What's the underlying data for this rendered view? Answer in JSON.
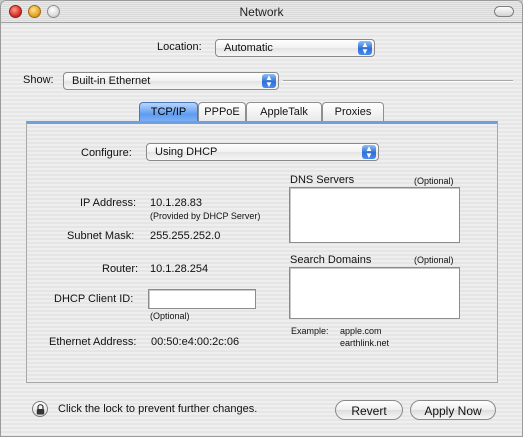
{
  "window": {
    "title": "Network"
  },
  "location": {
    "label": "Location:",
    "value": "Automatic"
  },
  "show": {
    "label": "Show:",
    "value": "Built-in Ethernet"
  },
  "tabs": [
    "TCP/IP",
    "PPPoE",
    "AppleTalk",
    "Proxies"
  ],
  "active_tab": "TCP/IP",
  "configure": {
    "label": "Configure:",
    "value": "Using DHCP"
  },
  "ip": {
    "label": "IP Address:",
    "value": "10.1.28.83",
    "note": "(Provided by DHCP Server)"
  },
  "subnet": {
    "label": "Subnet Mask:",
    "value": "255.255.252.0"
  },
  "router": {
    "label": "Router:",
    "value": "10.1.28.254"
  },
  "dhcp_client_id": {
    "label": "DHCP Client ID:",
    "value": "",
    "note": "(Optional)"
  },
  "ethernet": {
    "label": "Ethernet Address:",
    "value": "00:50:e4:00:2c:06"
  },
  "dns": {
    "label": "DNS Servers",
    "optional": "(Optional)",
    "value": ""
  },
  "search_domains": {
    "label": "Search Domains",
    "optional": "(Optional)",
    "value": "",
    "example_label": "Example:",
    "example_1": "apple.com",
    "example_2": "earthlink.net"
  },
  "footer": {
    "lock_text": "Click the lock to prevent further changes.",
    "revert": "Revert",
    "apply": "Apply Now"
  },
  "colors": {
    "accent": "#5e9cf0",
    "close": "#d9322a",
    "minimize": "#e8a52a"
  },
  "icons": {
    "lock": "lock-icon",
    "popup": "popup-arrows-icon"
  }
}
